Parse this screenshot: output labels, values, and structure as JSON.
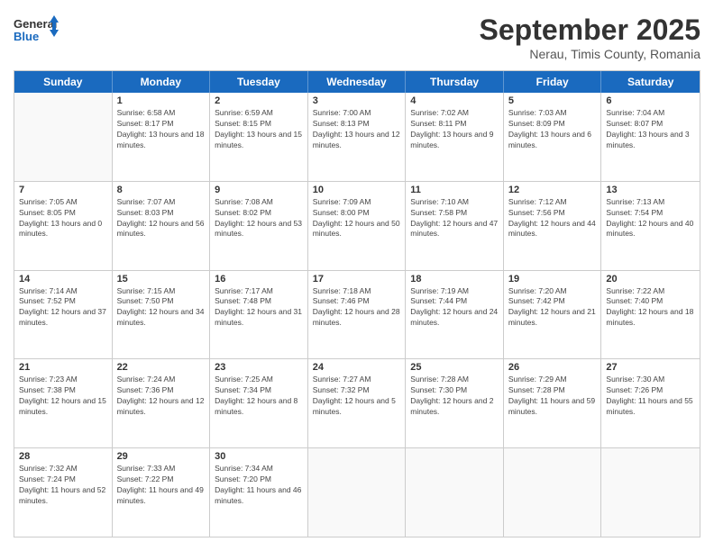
{
  "logo": {
    "line1": "General",
    "line2": "Blue"
  },
  "title": "September 2025",
  "subtitle": "Nerau, Timis County, Romania",
  "days_header": [
    "Sunday",
    "Monday",
    "Tuesday",
    "Wednesday",
    "Thursday",
    "Friday",
    "Saturday"
  ],
  "weeks": [
    [
      {
        "day": "",
        "empty": true
      },
      {
        "day": "1",
        "sunrise": "6:58 AM",
        "sunset": "8:17 PM",
        "daylight": "13 hours and 18 minutes."
      },
      {
        "day": "2",
        "sunrise": "6:59 AM",
        "sunset": "8:15 PM",
        "daylight": "13 hours and 15 minutes."
      },
      {
        "day": "3",
        "sunrise": "7:00 AM",
        "sunset": "8:13 PM",
        "daylight": "13 hours and 12 minutes."
      },
      {
        "day": "4",
        "sunrise": "7:02 AM",
        "sunset": "8:11 PM",
        "daylight": "13 hours and 9 minutes."
      },
      {
        "day": "5",
        "sunrise": "7:03 AM",
        "sunset": "8:09 PM",
        "daylight": "13 hours and 6 minutes."
      },
      {
        "day": "6",
        "sunrise": "7:04 AM",
        "sunset": "8:07 PM",
        "daylight": "13 hours and 3 minutes."
      }
    ],
    [
      {
        "day": "7",
        "sunrise": "7:05 AM",
        "sunset": "8:05 PM",
        "daylight": "13 hours and 0 minutes."
      },
      {
        "day": "8",
        "sunrise": "7:07 AM",
        "sunset": "8:03 PM",
        "daylight": "12 hours and 56 minutes."
      },
      {
        "day": "9",
        "sunrise": "7:08 AM",
        "sunset": "8:02 PM",
        "daylight": "12 hours and 53 minutes."
      },
      {
        "day": "10",
        "sunrise": "7:09 AM",
        "sunset": "8:00 PM",
        "daylight": "12 hours and 50 minutes."
      },
      {
        "day": "11",
        "sunrise": "7:10 AM",
        "sunset": "7:58 PM",
        "daylight": "12 hours and 47 minutes."
      },
      {
        "day": "12",
        "sunrise": "7:12 AM",
        "sunset": "7:56 PM",
        "daylight": "12 hours and 44 minutes."
      },
      {
        "day": "13",
        "sunrise": "7:13 AM",
        "sunset": "7:54 PM",
        "daylight": "12 hours and 40 minutes."
      }
    ],
    [
      {
        "day": "14",
        "sunrise": "7:14 AM",
        "sunset": "7:52 PM",
        "daylight": "12 hours and 37 minutes."
      },
      {
        "day": "15",
        "sunrise": "7:15 AM",
        "sunset": "7:50 PM",
        "daylight": "12 hours and 34 minutes."
      },
      {
        "day": "16",
        "sunrise": "7:17 AM",
        "sunset": "7:48 PM",
        "daylight": "12 hours and 31 minutes."
      },
      {
        "day": "17",
        "sunrise": "7:18 AM",
        "sunset": "7:46 PM",
        "daylight": "12 hours and 28 minutes."
      },
      {
        "day": "18",
        "sunrise": "7:19 AM",
        "sunset": "7:44 PM",
        "daylight": "12 hours and 24 minutes."
      },
      {
        "day": "19",
        "sunrise": "7:20 AM",
        "sunset": "7:42 PM",
        "daylight": "12 hours and 21 minutes."
      },
      {
        "day": "20",
        "sunrise": "7:22 AM",
        "sunset": "7:40 PM",
        "daylight": "12 hours and 18 minutes."
      }
    ],
    [
      {
        "day": "21",
        "sunrise": "7:23 AM",
        "sunset": "7:38 PM",
        "daylight": "12 hours and 15 minutes."
      },
      {
        "day": "22",
        "sunrise": "7:24 AM",
        "sunset": "7:36 PM",
        "daylight": "12 hours and 12 minutes."
      },
      {
        "day": "23",
        "sunrise": "7:25 AM",
        "sunset": "7:34 PM",
        "daylight": "12 hours and 8 minutes."
      },
      {
        "day": "24",
        "sunrise": "7:27 AM",
        "sunset": "7:32 PM",
        "daylight": "12 hours and 5 minutes."
      },
      {
        "day": "25",
        "sunrise": "7:28 AM",
        "sunset": "7:30 PM",
        "daylight": "12 hours and 2 minutes."
      },
      {
        "day": "26",
        "sunrise": "7:29 AM",
        "sunset": "7:28 PM",
        "daylight": "11 hours and 59 minutes."
      },
      {
        "day": "27",
        "sunrise": "7:30 AM",
        "sunset": "7:26 PM",
        "daylight": "11 hours and 55 minutes."
      }
    ],
    [
      {
        "day": "28",
        "sunrise": "7:32 AM",
        "sunset": "7:24 PM",
        "daylight": "11 hours and 52 minutes."
      },
      {
        "day": "29",
        "sunrise": "7:33 AM",
        "sunset": "7:22 PM",
        "daylight": "11 hours and 49 minutes."
      },
      {
        "day": "30",
        "sunrise": "7:34 AM",
        "sunset": "7:20 PM",
        "daylight": "11 hours and 46 minutes."
      },
      {
        "day": "",
        "empty": true
      },
      {
        "day": "",
        "empty": true
      },
      {
        "day": "",
        "empty": true
      },
      {
        "day": "",
        "empty": true
      }
    ]
  ]
}
